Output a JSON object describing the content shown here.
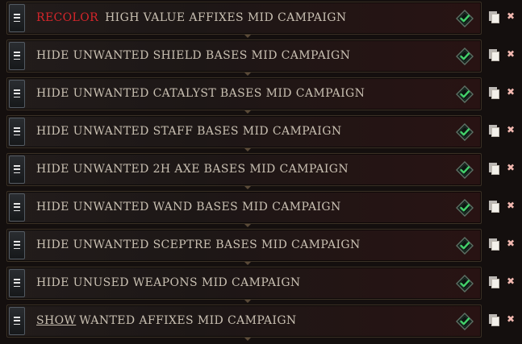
{
  "rules": [
    {
      "prefix": "RECOLOR",
      "prefix_style": "keyword",
      "text": "HIGH VALUE AFFIXES MID CAMPAIGN",
      "enabled": true
    },
    {
      "prefix": "",
      "prefix_style": "",
      "text": "HIDE UNWANTED SHIELD BASES MID CAMPAIGN",
      "enabled": true
    },
    {
      "prefix": "",
      "prefix_style": "",
      "text": "HIDE UNWANTED CATALYST BASES MID CAMPAIGN",
      "enabled": true
    },
    {
      "prefix": "",
      "prefix_style": "",
      "text": "HIDE UNWANTED STAFF BASES MID CAMPAIGN",
      "enabled": true
    },
    {
      "prefix": "",
      "prefix_style": "",
      "text": "HIDE UNWANTED 2H AXE BASES MID CAMPAIGN",
      "enabled": true
    },
    {
      "prefix": "",
      "prefix_style": "",
      "text": "HIDE UNWANTED WAND BASES MID CAMPAIGN",
      "enabled": true
    },
    {
      "prefix": "",
      "prefix_style": "",
      "text": "HIDE UNWANTED SCEPTRE BASES MID CAMPAIGN",
      "enabled": true
    },
    {
      "prefix": "",
      "prefix_style": "",
      "text": "HIDE UNUSED WEAPONS MID CAMPAIGN",
      "enabled": true
    },
    {
      "prefix": "SHOW",
      "prefix_style": "underline",
      "text": "WANTED AFFIXES MID CAMPAIGN",
      "enabled": true
    }
  ],
  "icons": {
    "drag": "drag-handle-icon",
    "toggle": "checkmark-diamond-icon",
    "copy": "copy-icon",
    "delete": "close-icon"
  },
  "colors": {
    "keyword_recolor": "#d7262b",
    "label_text": "#c9c0b2",
    "check_green": "#43d16a",
    "delete_x": "#f2b8b0"
  }
}
